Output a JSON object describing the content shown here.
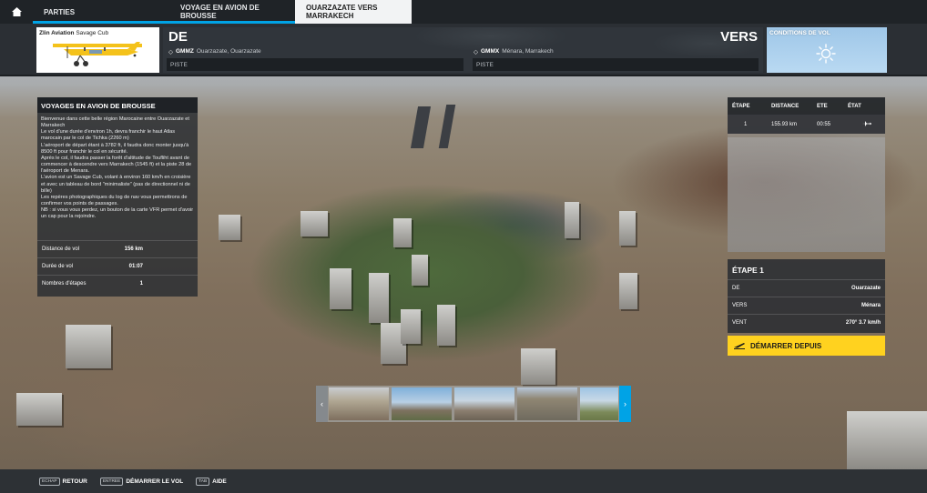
{
  "top_tabs": {
    "parties": "PARTIES",
    "bush_trips": "VOYAGE EN AVION DE BROUSSE",
    "current_trip": "OUARZAZATE VERS MARRAKECH"
  },
  "aircraft": {
    "maker": "Zlin Aviation",
    "model": "Savage Cub"
  },
  "route": {
    "from_label": "DE",
    "to_label": "VERS",
    "from_icao": "GMMZ",
    "from_name": "Ouarzazate, Ouarzazate",
    "to_icao": "GMMX",
    "to_name": "Ménara, Marrakech",
    "runway_label": "PISTE"
  },
  "conditions": {
    "label": "CONDITIONS DE VOL",
    "icon": "sun-icon"
  },
  "info_panel": {
    "title": "VOYAGES EN AVION DE BROUSSE",
    "description": [
      "Bienvenue dans cette belle région Marocaine entre Ouarzazate et Marrakech",
      "Le vol d'une durée d'environ 1h, devra franchir le haut Atlas marocain par le col de Tichka (2260 m)",
      "L'aéroport de départ étant à 3782 ft, il faudra donc monter jusqu'à 8500 ft pour franchir le col en sécurité.",
      "Après le col, il faudra passer la forêt d'altitude de Toufliht avant de commencer à descendre vers Marrakech (1545 ft) et la piste 28 de l'aéroport de Menara.",
      "L'avion est un Savage Cub, volant à environ 160 km/h en croisière et avec un tableau de bord \"minimaliste\" (pas de directionnel ni de bille)",
      "Les repères photographiques du log de nav vous permettrons de confirmer vos points de passages.",
      "NB : si vous vous perdez, un bouton de la carte VFR permet d'avoir un cap pour la rejoindre."
    ],
    "stats": [
      {
        "label": "Distance de vol",
        "value": "156 km"
      },
      {
        "label": "Durée de vol",
        "value": "01:07"
      },
      {
        "label": "Nombres d'étapes",
        "value": "1"
      }
    ]
  },
  "etapes_table": {
    "headers": [
      "ÉTAPE",
      "DISTANCE",
      "ETE",
      "ÉTAT"
    ],
    "rows": [
      {
        "etape": "1",
        "distance": "155.93 km",
        "ete": "00:55",
        "etat_icon": "plane-icon"
      }
    ]
  },
  "etape_detail": {
    "title": "ÉTAPE 1",
    "rows": [
      {
        "label": "DE",
        "value": "Ouarzazate"
      },
      {
        "label": "VERS",
        "value": "Ménara"
      },
      {
        "label": "VENT",
        "value": "270° 3.7 km/h"
      }
    ],
    "start_button": "DÉMARRER DEPUIS"
  },
  "bottom_bar": {
    "hints": [
      {
        "key": "ECHAP",
        "label": "RETOUR"
      },
      {
        "key": "ENTREE",
        "label": "DÉMARRER LE VOL"
      },
      {
        "key": "TAB",
        "label": "AIDE"
      }
    ]
  },
  "colors": {
    "accent": "#00a3e6",
    "start_button": "#ffd21f"
  }
}
